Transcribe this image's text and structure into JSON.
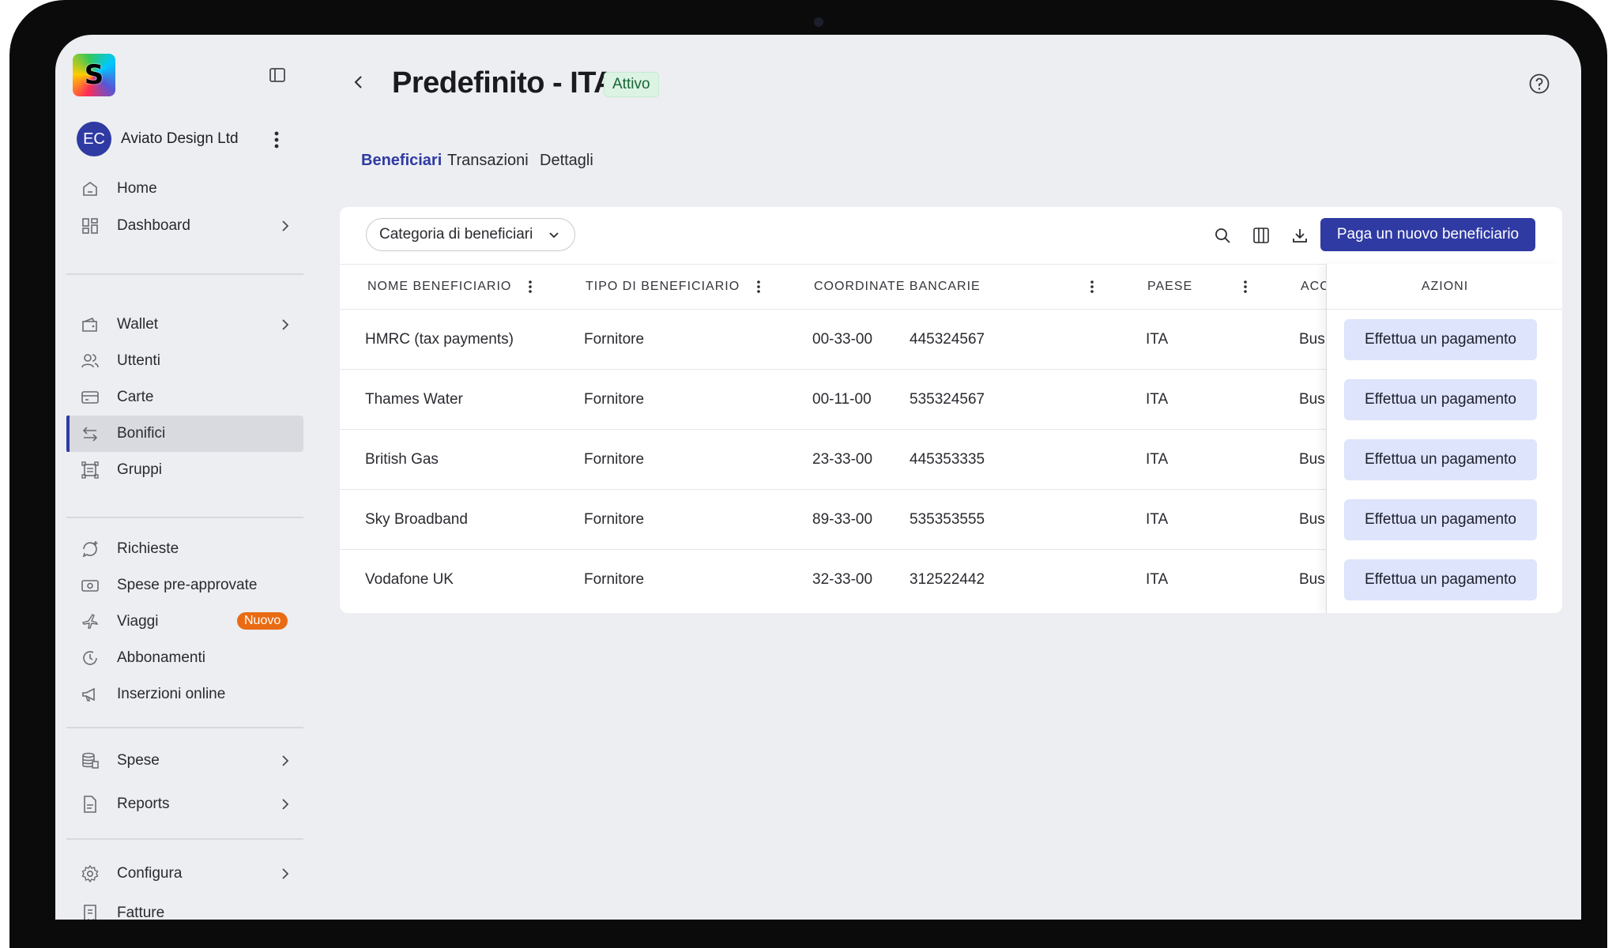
{
  "sidebar": {
    "logo_letter": "S",
    "account": {
      "initials": "EC",
      "name": "Aviato Design Ltd"
    },
    "items": [
      {
        "label": "Home",
        "icon": "home-icon"
      },
      {
        "label": "Dashboard",
        "icon": "dashboard-icon"
      },
      {
        "label": "Wallet",
        "icon": "wallet-icon"
      },
      {
        "label": "Uttenti",
        "icon": "users-icon"
      },
      {
        "label": "Carte",
        "icon": "card-icon"
      },
      {
        "label": "Bonifici",
        "icon": "transfer-icon",
        "active": true
      },
      {
        "label": "Gruppi",
        "icon": "groups-icon"
      },
      {
        "label": "Richieste",
        "icon": "request-icon"
      },
      {
        "label": "Spese pre-approvate",
        "icon": "pre-approved-icon"
      },
      {
        "label": "Viaggi",
        "icon": "plane-icon",
        "badge": "Nuovo"
      },
      {
        "label": "Abbonamenti",
        "icon": "subscription-icon"
      },
      {
        "label": "Inserzioni online",
        "icon": "megaphone-icon"
      },
      {
        "label": "Spese",
        "icon": "expenses-icon"
      },
      {
        "label": "Reports",
        "icon": "report-icon"
      },
      {
        "label": "Configura",
        "icon": "gear-icon"
      },
      {
        "label": "Fatture",
        "icon": "invoice-icon"
      }
    ]
  },
  "header": {
    "title": "Predefinito - ITA",
    "status": "Attivo"
  },
  "tabs": [
    "Beneficiari",
    "Transazioni",
    "Dettagli"
  ],
  "toolbar": {
    "filter_label": "Categoria di beneficiari",
    "primary_label": "Paga un nuovo beneficiario"
  },
  "table": {
    "columns": [
      "NOME BENEFICIARIO",
      "TIPO DI BENEFICIARIO",
      "COORDINATE BANCARIE",
      "PAESE",
      "ACC",
      "AZIONI"
    ],
    "rows": [
      {
        "name": "HMRC (tax payments)",
        "type": "Fornitore",
        "sort": "00-33-00",
        "account": "445324567",
        "country": "ITA",
        "acc": "Busi",
        "action": "Effettua un pagamento"
      },
      {
        "name": "Thames Water",
        "type": "Fornitore",
        "sort": "00-11-00",
        "account": "535324567",
        "country": "ITA",
        "acc": "Busi",
        "action": "Effettua un pagamento"
      },
      {
        "name": "British Gas",
        "type": "Fornitore",
        "sort": "23-33-00",
        "account": "445353335",
        "country": "ITA",
        "acc": "Busi",
        "action": "Effettua un pagamento"
      },
      {
        "name": "Sky Broadband",
        "type": "Fornitore",
        "sort": "89-33-00",
        "account": "535353555",
        "country": "ITA",
        "acc": "Busi",
        "action": "Effettua un pagamento"
      },
      {
        "name": "Vodafone UK",
        "type": "Fornitore",
        "sort": "32-33-00",
        "account": "312522442",
        "country": "ITA",
        "acc": "Busi",
        "action": "Effettua un pagamento"
      }
    ]
  },
  "colors": {
    "accent": "#2f3aa3",
    "badge_new": "#e96b13",
    "status_bg": "#dcf3e4",
    "pay_button_bg": "#dde4fb"
  }
}
